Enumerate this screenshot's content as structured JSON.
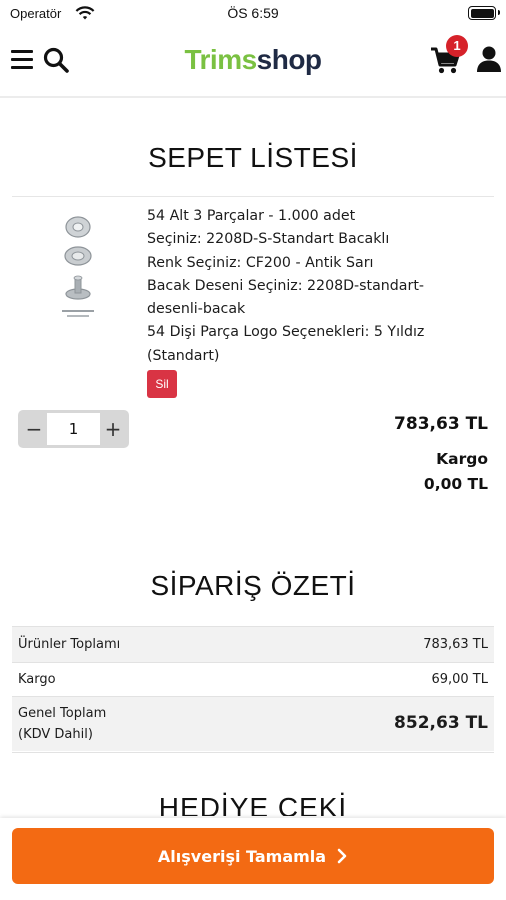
{
  "status_bar": {
    "carrier": "Operatör",
    "time": "ÖS 6:59"
  },
  "header": {
    "logo_part1": "Trims",
    "logo_part2": "shop",
    "cart_count": "1",
    "icons": [
      "menu-icon",
      "search-icon",
      "cart-icon",
      "user-icon"
    ]
  },
  "cart": {
    "title": "SEPET LİSTESİ",
    "item": {
      "details": [
        "54 Alt 3 Parçalar - 1.000 adet",
        "Seçiniz: 2208D-S-Standart Bacaklı",
        "Renk Seçiniz: CF200 - Antik Sarı",
        "Bacak Deseni Seçiniz: 2208D-standart-",
        "desenli-bacak",
        "54 Dişi Parça Logo Seçenekleri: 5 Yıldız",
        "(Standart)"
      ],
      "delete_label": "Sil",
      "quantity": "1",
      "minus_label": "−",
      "plus_label": "+",
      "line_total": "783,63 TL",
      "shipping_label": "Kargo",
      "shipping_value": "0,00 TL"
    }
  },
  "summary": {
    "title": "SİPARİŞ ÖZETİ",
    "rows": [
      {
        "label": "Ürünler Toplamı",
        "value": "783,63 TL"
      },
      {
        "label": "Kargo",
        "value": "69,00 TL"
      },
      {
        "label_line1": "Genel Toplam",
        "label_line2": "(KDV Dahil)",
        "value": "852,63 TL"
      }
    ]
  },
  "gift": {
    "title": "HEDİYE ÇEKİ"
  },
  "checkout": {
    "label": "Alışverişi Tamamla"
  },
  "colors": {
    "brand_green": "#7ac142",
    "brand_navy": "#1f2a44",
    "accent_orange": "#f36a13",
    "badge_red": "#d6222a",
    "delete_red": "#d93444",
    "total_green": "#1c9a3c"
  }
}
